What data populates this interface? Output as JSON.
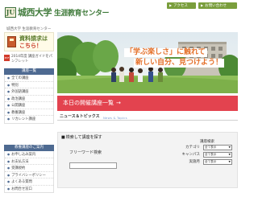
{
  "header": {
    "logo_mark": "JU",
    "university": "城西大学",
    "center": "生涯教育センター",
    "access": "アクセス",
    "contact": "お問い合わせ"
  },
  "breadcrumb": "城西大学 生涯教育センター",
  "sidebar": {
    "request_title": "資料請求は",
    "request_click": "こちら！",
    "pdf_note": "2014年度 講座ガイドをパンフレット",
    "courses_head": "講座一覧",
    "courses": [
      "全ての講座",
      "特別",
      "外国語講座",
      "政治講座",
      "公開講座",
      "教養講座",
      "リカレント講座"
    ],
    "guide_head": "教養講座のご案内",
    "guide": [
      "お申し込み案内",
      "お支払方法",
      "受講規約",
      "プライバシーポリシー",
      "よくある質問",
      "お問合せ窓口"
    ]
  },
  "hero": {
    "line1": "「学ぶ楽しさ」に触れて",
    "line2": "新しい自分、見つけよう！"
  },
  "today": {
    "label": "本日の開催講座一覧",
    "arrow": "→"
  },
  "news": {
    "title": "ニュース＆トピックス",
    "en": "News & Topics"
  },
  "search": {
    "title": "検索して講座を探す",
    "freeword": "フリーワード検索",
    "condition": "講座検索",
    "rows": [
      {
        "label": "カテゴリ",
        "value": "全て表示"
      },
      {
        "label": "キャンパス",
        "value": "全て表示"
      },
      {
        "label": "実施月",
        "value": "全て表示"
      }
    ]
  },
  "colors": {
    "accent_green": "#7a9e3c",
    "nav_blue": "#4e6a91",
    "today_red": "#e3434f",
    "hero_orange": "#e4702a"
  }
}
